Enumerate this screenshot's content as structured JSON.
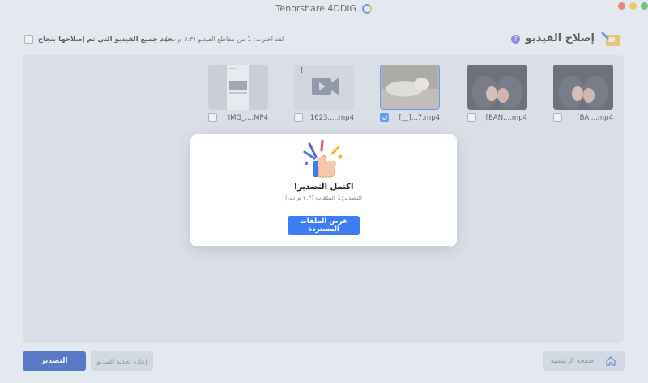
{
  "app": {
    "title": "Tenorshare 4DDiG"
  },
  "header": {
    "page_title": "إصلاح الفيديو",
    "help_badge": "?",
    "select_all_label": "حدد جميع الفيديو التي تم إصلاحها بنجاح",
    "selection_info": "لقد اخترت: 1 من مقاطع الفيديو (٧.٣ م.ب.)"
  },
  "videos": [
    {
      "name": "[BA....mp4",
      "checked": false,
      "thumb": "photo-hands"
    },
    {
      "name": "[BAN....mp4",
      "checked": false,
      "thumb": "photo-hands"
    },
    {
      "name": "[__]...7.mp4",
      "checked": true,
      "thumb": "photo-object"
    },
    {
      "name": "1623.....mp4",
      "checked": false,
      "thumb": "video-placeholder",
      "badge": "!"
    },
    {
      "name": "IMG_....MP4",
      "checked": false,
      "thumb": "phone-screenshot"
    }
  ],
  "modal": {
    "title": "اكتمل التصدير!",
    "subtitle": "التصدير:1 الملفات (٧.٣ م.ب.)",
    "button_label": "عرض الملفات المستردة",
    "icon": "thumbs-up-celebration-icon"
  },
  "footer": {
    "export_label": "التصدير",
    "refresh_label": "إعادة تحديد الفيديو",
    "home_label": "صفحة الرئيسية"
  },
  "colors": {
    "accent": "#3d7df3",
    "export_button": "#1a47b8",
    "checked": "#2f7bf6"
  }
}
